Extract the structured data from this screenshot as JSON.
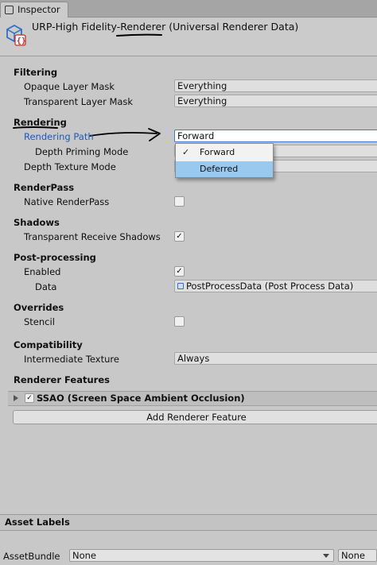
{
  "tab": {
    "title": "Inspector"
  },
  "header": {
    "title": "URP-High Fidelity-Renderer (Universal Renderer Data)"
  },
  "filtering": {
    "heading": "Filtering",
    "opaque_label": "Opaque Layer Mask",
    "opaque_value": "Everything",
    "transparent_label": "Transparent Layer Mask",
    "transparent_value": "Everything"
  },
  "rendering": {
    "heading": "Rendering",
    "path_label": "Rendering Path",
    "path_value": "Forward",
    "depth_priming_label": "Depth Priming Mode",
    "depth_texture_label": "Depth Texture Mode"
  },
  "dropdown": {
    "options": [
      {
        "label": "Forward",
        "checked": true
      },
      {
        "label": "Deferred",
        "highlighted": true
      }
    ],
    "check_glyph": "✓"
  },
  "renderpass": {
    "heading": "RenderPass",
    "native_label": "Native RenderPass",
    "native_checked": false
  },
  "shadows": {
    "heading": "Shadows",
    "receive_label": "Transparent Receive Shadows",
    "receive_checked": true
  },
  "postprocessing": {
    "heading": "Post-processing",
    "enabled_label": "Enabled",
    "enabled_checked": true,
    "data_label": "Data",
    "data_value": "PostProcessData (Post Process Data)"
  },
  "overrides": {
    "heading": "Overrides",
    "stencil_label": "Stencil",
    "stencil_checked": false
  },
  "compatibility": {
    "heading": "Compatibility",
    "intermediate_label": "Intermediate Texture",
    "intermediate_value": "Always"
  },
  "features": {
    "heading": "Renderer Features",
    "items": [
      {
        "name": "SSAO (Screen Space Ambient Occlusion)",
        "enabled": true
      }
    ],
    "add_button": "Add Renderer Feature"
  },
  "asset_labels": {
    "heading": "Asset Labels",
    "bundle_label": "AssetBundle",
    "bundle_value": "None",
    "variant_value": "None"
  },
  "colors": {
    "accent_blue": "#1f5bb5",
    "selection": "#99c9ef",
    "annotation": "#000000"
  },
  "icons": {
    "tab": "inspector-icon",
    "asset": "renderer-asset-icon",
    "data": "scriptable-object-icon"
  }
}
